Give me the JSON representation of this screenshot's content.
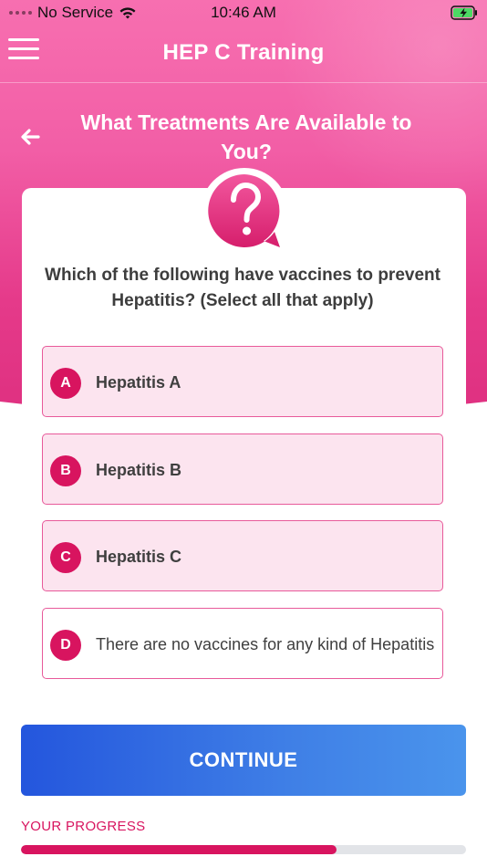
{
  "status_bar": {
    "carrier": "No Service",
    "time": "10:46 AM"
  },
  "nav": {
    "title": "HEP C Training"
  },
  "page": {
    "title": "What Treatments Are Available to You?"
  },
  "question": {
    "text": "Which of the following have vaccines to prevent Hepatitis? (Select all that apply)",
    "icon": "question-mark-bubble-icon"
  },
  "options": [
    {
      "letter": "A",
      "label": "Hepatitis A",
      "selected": true
    },
    {
      "letter": "B",
      "label": "Hepatitis B",
      "selected": true
    },
    {
      "letter": "C",
      "label": "Hepatitis C",
      "selected": true
    },
    {
      "letter": "D",
      "label": "There are no vaccines for any kind of Hepatitis",
      "selected": false
    }
  ],
  "continue_label": "CONTINUE",
  "progress": {
    "label": "YOUR PROGRESS",
    "fraction": 0.71
  },
  "colors": {
    "brand_pink": "#d8145f",
    "header_gradient_top": "#f76fb0",
    "header_gradient_bottom": "#de2f7f",
    "option_selected_bg": "#fce4ef",
    "option_border": "#e85a9a",
    "continue_gradient_start": "#2456dd",
    "continue_gradient_end": "#4a94ec",
    "progress_track": "#e2e4e8"
  }
}
